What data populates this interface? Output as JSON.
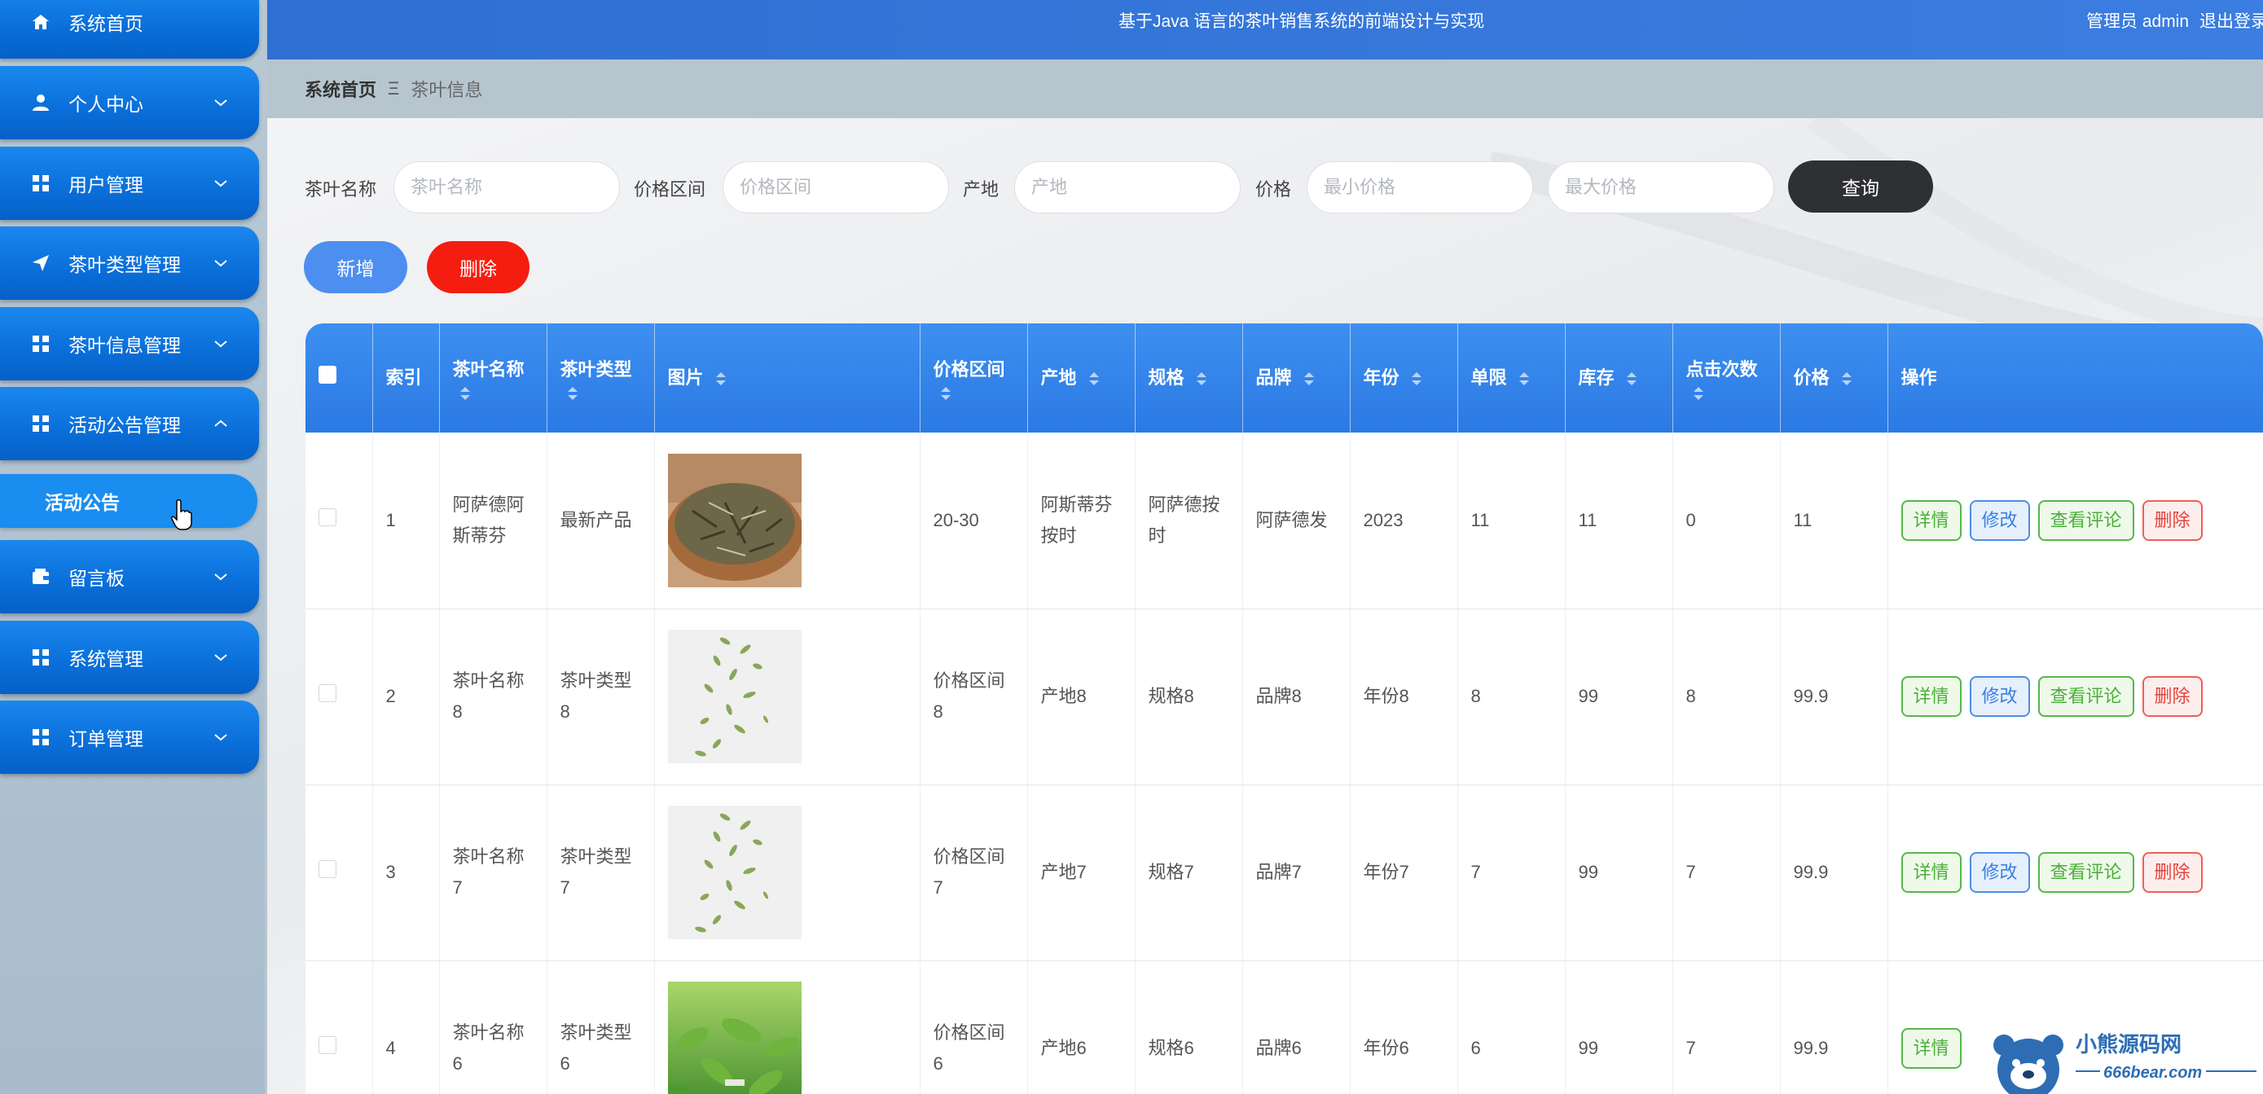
{
  "sidebar": {
    "items": [
      {
        "label": "系统首页",
        "icon": "home-icon"
      },
      {
        "label": "个人中心",
        "icon": "user-icon"
      },
      {
        "label": "用户管理",
        "icon": "grid-icon"
      },
      {
        "label": "茶叶类型管理",
        "icon": "send-icon"
      },
      {
        "label": "茶叶信息管理",
        "icon": "grid-icon"
      },
      {
        "label": "活动公告管理",
        "icon": "grid-icon"
      },
      {
        "label": "留言板",
        "icon": "wallet-icon"
      },
      {
        "label": "系统管理",
        "icon": "grid-icon"
      },
      {
        "label": "订单管理",
        "icon": "grid-icon"
      }
    ],
    "submenu_item": "活动公告"
  },
  "header": {
    "title": "基于Java 语言的茶叶销售系统的前端设计与实现",
    "user": "管理员 admin",
    "logout": "退出登录"
  },
  "breadcrumb": {
    "home": "系统首页",
    "separator": "Ξ",
    "current": "茶叶信息"
  },
  "search": {
    "name_label": "茶叶名称",
    "name_placeholder": "茶叶名称",
    "range_label": "价格区间",
    "range_placeholder": "价格区间",
    "origin_label": "产地",
    "origin_placeholder": "产地",
    "price_label": "价格",
    "min_placeholder": "最小价格",
    "max_placeholder": "最大价格",
    "query_button": "查询"
  },
  "actions": {
    "add": "新增",
    "delete": "删除"
  },
  "table": {
    "columns": [
      "索引",
      "茶叶名称",
      "茶叶类型",
      "图片",
      "价格区间",
      "产地",
      "规格",
      "品牌",
      "年份",
      "单限",
      "库存",
      "点击次数",
      "价格",
      "操作"
    ],
    "rows": [
      {
        "index": "1",
        "name": "阿萨德阿斯蒂芬",
        "type": "最新产品",
        "range": "20-30",
        "origin": "阿斯蒂芬按时",
        "spec": "阿萨德按时",
        "brand": "阿萨德发",
        "year": "2023",
        "limit": "11",
        "stock": "11",
        "clicks": "0",
        "price": "11",
        "image": "dried-tea-bowl"
      },
      {
        "index": "2",
        "name": "茶叶名称8",
        "type": "茶叶类型8",
        "range": "价格区间8",
        "origin": "产地8",
        "spec": "规格8",
        "brand": "品牌8",
        "year": "年份8",
        "limit": "8",
        "stock": "99",
        "clicks": "8",
        "price": "99.9",
        "image": "falling-leaves"
      },
      {
        "index": "3",
        "name": "茶叶名称7",
        "type": "茶叶类型7",
        "range": "价格区间7",
        "origin": "产地7",
        "spec": "规格7",
        "brand": "品牌7",
        "year": "年份7",
        "limit": "7",
        "stock": "99",
        "clicks": "7",
        "price": "99.9",
        "image": "falling-leaves"
      },
      {
        "index": "4",
        "name": "茶叶名称6",
        "type": "茶叶类型6",
        "range": "价格区间6",
        "origin": "产地6",
        "spec": "规格6",
        "brand": "品牌6",
        "year": "年份6",
        "limit": "6",
        "stock": "99",
        "clicks": "7",
        "price": "99.9",
        "image": "green-tea-field"
      }
    ],
    "row_actions": {
      "detail": "详情",
      "edit": "修改",
      "review": "查看评论",
      "delete": "删除"
    }
  },
  "watermark": {
    "title": "小熊源码网",
    "url": "666bear.com"
  },
  "colors": {
    "sidebar_item": "#0a6ed9",
    "header": "#2f6fd3",
    "table_header": "#3d8ff0",
    "query_button": "#2f3033",
    "add_button": "#4d8ff0",
    "delete_button": "#f51d0f"
  }
}
